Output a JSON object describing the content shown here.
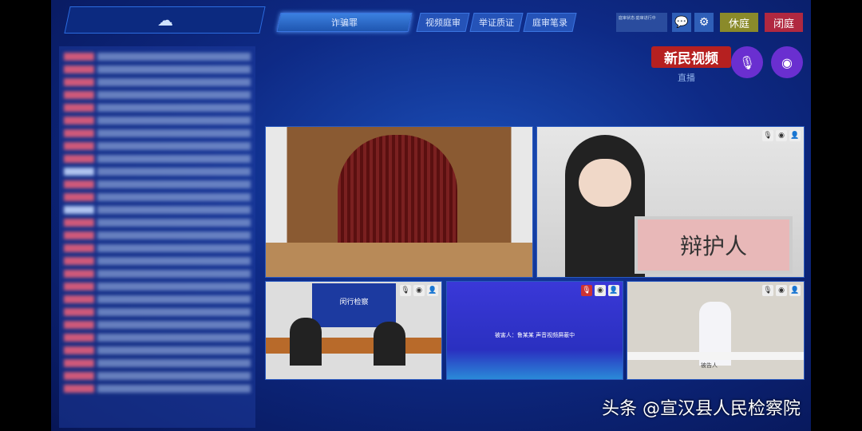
{
  "header": {
    "logo_icon": "cloud-icon",
    "case_tab": "诈骗罪",
    "tabs": [
      "视频庭审",
      "举证质证",
      "庭审笔录"
    ],
    "status": "庭审状态:庭审进行中",
    "recess": "休庭",
    "close": "闭庭",
    "recess_color": "#8a8a2a",
    "close_color": "#b02840"
  },
  "broadcast": {
    "brand": "新民视频",
    "live": "直播"
  },
  "videos": {
    "defense_sign": "辩护人",
    "procuratorate_sign": "闵行检察",
    "defendant_sign": "被告人",
    "victim_text": "被害人：鲁某某  声音视频屏蔽中"
  },
  "watermark": "头条 @宣汉县人民检察院"
}
